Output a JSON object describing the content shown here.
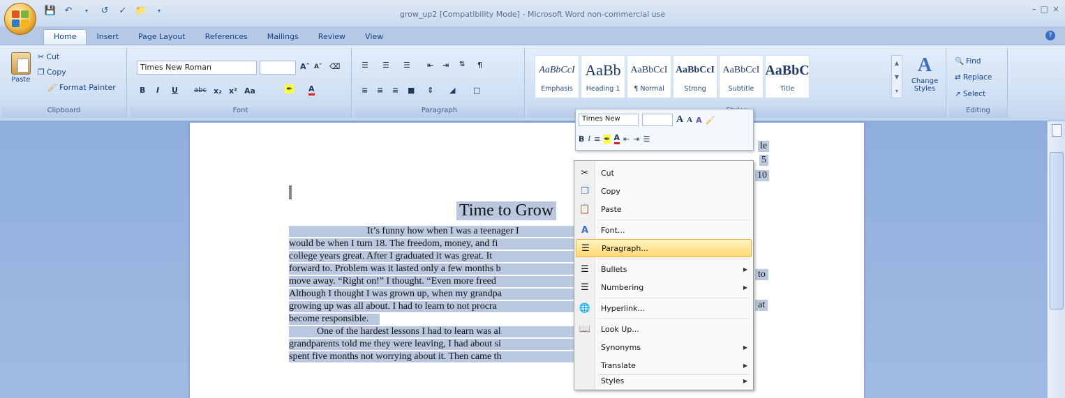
{
  "window": {
    "title": "grow_up2 [Compatibility Mode] - Microsoft Word non-commercial use",
    "controls": [
      "–",
      "□",
      "×"
    ]
  },
  "quick_access": {
    "icons": [
      "save-icon",
      "undo-icon",
      "redo-icon",
      "spelling-icon",
      "folder-icon"
    ]
  },
  "tabs": [
    {
      "label": "Home"
    },
    {
      "label": "Insert"
    },
    {
      "label": "Page Layout"
    },
    {
      "label": "References"
    },
    {
      "label": "Mailings"
    },
    {
      "label": "Review"
    },
    {
      "label": "View"
    }
  ],
  "ribbon": {
    "clipboard": {
      "paste_label": "Paste",
      "cut_label": "Cut",
      "copy_label": "Copy",
      "format_painter_label": "Format Painter",
      "group_label": "Clipboard"
    },
    "font": {
      "font_name": "Times New Roman",
      "font_size": "",
      "group_label": "Font"
    },
    "paragraph": {
      "group_label": "Paragraph"
    },
    "styles": {
      "items": [
        {
          "preview": "AaBbCcI",
          "name": "Emphasis"
        },
        {
          "preview": "AaBb",
          "name": "Heading 1"
        },
        {
          "preview": "AaBbCcI",
          "name": "¶ Normal"
        },
        {
          "preview": "AaBbCcI",
          "name": "Strong"
        },
        {
          "preview": "AaBbCcI",
          "name": "Subtitle"
        },
        {
          "preview": "AaBbC",
          "name": "Title"
        }
      ],
      "change_styles_label": "Change Styles",
      "group_label": "Styles"
    },
    "editing": {
      "find_label": "Find",
      "replace_label": "Replace",
      "select_label": "Select",
      "group_label": "Editing"
    }
  },
  "mini_toolbar": {
    "font_name": "Times New",
    "font_size": ""
  },
  "context_menu": {
    "items": [
      {
        "label": "Cut",
        "icon": "scissors-icon",
        "submenu": false
      },
      {
        "label": "Copy",
        "icon": "copy-icon",
        "submenu": false
      },
      {
        "label": "Paste",
        "icon": "paste-icon",
        "submenu": false
      },
      {
        "label": "Font...",
        "icon": "font-icon",
        "submenu": false
      },
      {
        "label": "Paragraph...",
        "icon": "paragraph-icon",
        "submenu": false,
        "highlighted": true
      },
      {
        "label": "Bullets",
        "icon": "bullets-icon",
        "submenu": true
      },
      {
        "label": "Numbering",
        "icon": "numbering-icon",
        "submenu": true
      },
      {
        "label": "Hyperlink...",
        "icon": "hyperlink-icon",
        "submenu": false
      },
      {
        "label": "Look Up...",
        "icon": "lookup-icon",
        "submenu": false
      },
      {
        "label": "Synonyms",
        "icon": "",
        "submenu": true
      },
      {
        "label": "Translate",
        "icon": "",
        "submenu": true
      },
      {
        "label": "Styles",
        "icon": "",
        "submenu": true
      }
    ]
  },
  "document": {
    "header_lines": [
      "le",
      "5",
      "10"
    ],
    "title": "Time to Grow",
    "lines": [
      "It’s funny how when I was a teenager I",
      "would be when I turn 18.  The freedom, money, and fi",
      "college years great.  After I graduated it was great.  It",
      "forward to.  Problem was it lasted only a few months b",
      "move away.  “Right on!” I thought.  “Even more freed",
      "Although I thought I was grown up, when my grandpa",
      "growing up was all about.  I had to learn to not procra",
      "become responsible.",
      "One of the hardest lessons I had to learn was al",
      "grandparents told me they were leaving, I had about si",
      "spent five months not worrying about it.  Then came th"
    ],
    "right_overflow": [
      "to",
      "at"
    ]
  }
}
